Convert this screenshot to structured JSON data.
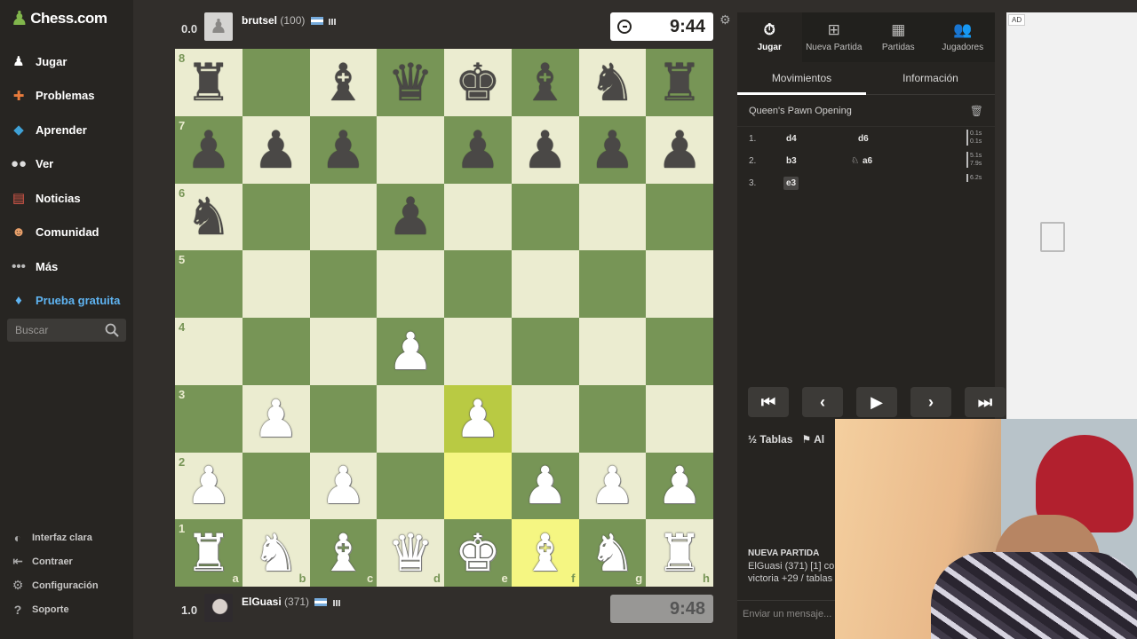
{
  "sidebar": {
    "logo": "Chess.com",
    "nav": [
      {
        "label": "Jugar",
        "icon": "play-icon"
      },
      {
        "label": "Problemas",
        "icon": "puzzle-icon"
      },
      {
        "label": "Aprender",
        "icon": "learn-icon"
      },
      {
        "label": "Ver",
        "icon": "watch-icon"
      },
      {
        "label": "Noticias",
        "icon": "news-icon"
      },
      {
        "label": "Comunidad",
        "icon": "community-icon"
      },
      {
        "label": "Más",
        "icon": "more-icon"
      },
      {
        "label": "Prueba gratuita",
        "icon": "diamond-icon"
      }
    ],
    "search_placeholder": "Buscar",
    "bottom": [
      {
        "label": "Interfaz clara",
        "icon": "theme-icon"
      },
      {
        "label": "Contraer",
        "icon": "collapse-icon"
      },
      {
        "label": "Configuración",
        "icon": "gear-icon"
      },
      {
        "label": "Soporte",
        "icon": "help-icon"
      }
    ]
  },
  "top_player": {
    "score": "0.0",
    "name": "brutsel",
    "rating": "(100)",
    "clock": "9:44"
  },
  "bottom_player": {
    "score": "1.0",
    "name": "ElGuasi",
    "rating": "(371)",
    "clock": "9:48"
  },
  "board": {
    "ranks": [
      "8",
      "7",
      "6",
      "5",
      "4",
      "3",
      "2",
      "1"
    ],
    "files": [
      "a",
      "b",
      "c",
      "d",
      "e",
      "f",
      "g",
      "h"
    ],
    "position": [
      [
        "bR",
        "",
        "bB",
        "bQ",
        "bK",
        "bB",
        "bN",
        "bR"
      ],
      [
        "bP",
        "bP",
        "bP",
        "",
        "bP",
        "bP",
        "bP",
        "bP"
      ],
      [
        "bN",
        "",
        "",
        "bP",
        "",
        "",
        "",
        ""
      ],
      [
        "",
        "",
        "",
        "",
        "",
        "",
        "",
        ""
      ],
      [
        "",
        "",
        "",
        "wP",
        "",
        "",
        "",
        ""
      ],
      [
        "",
        "wP",
        "",
        "",
        "wP",
        "",
        "",
        ""
      ],
      [
        "wP",
        "",
        "wP",
        "",
        "",
        "wP",
        "wP",
        "wP"
      ],
      [
        "wR",
        "wN",
        "wB",
        "wQ",
        "wK",
        "wB",
        "wN",
        "wR"
      ]
    ],
    "highlight": [
      "e3",
      "e2",
      "f1"
    ]
  },
  "panel": {
    "top_tabs": [
      {
        "label": "Jugar",
        "icon": "stopwatch-icon",
        "active": true
      },
      {
        "label": "Nueva Partida",
        "icon": "plus-icon",
        "active": false
      },
      {
        "label": "Partidas",
        "icon": "board-icon",
        "active": false
      },
      {
        "label": "Jugadores",
        "icon": "players-icon",
        "active": false
      }
    ],
    "sub_tabs": [
      "Movimientos",
      "Información"
    ],
    "opening": "Queen's Pawn Opening",
    "moves": [
      {
        "num": "1.",
        "white": "d4",
        "black": "d6",
        "t1": "0.1s",
        "t2": "0.1s"
      },
      {
        "num": "2.",
        "white": "b3",
        "black": "a6",
        "black_icon": "♘",
        "t1": "5.1s",
        "t2": "7.9s"
      },
      {
        "num": "3.",
        "white": "e3",
        "black": "",
        "t1": "6.2s",
        "t2": ""
      }
    ],
    "draw_label": "Tablas",
    "abort_label": "Al",
    "new_game_title": "NUEVA PARTIDA",
    "new_game_line1": "ElGuasi (371) [1] co",
    "new_game_line2": "victoria +29 / tablas",
    "chat_placeholder": "Enviar un mensaje..."
  },
  "ad": {
    "label": "AD"
  }
}
